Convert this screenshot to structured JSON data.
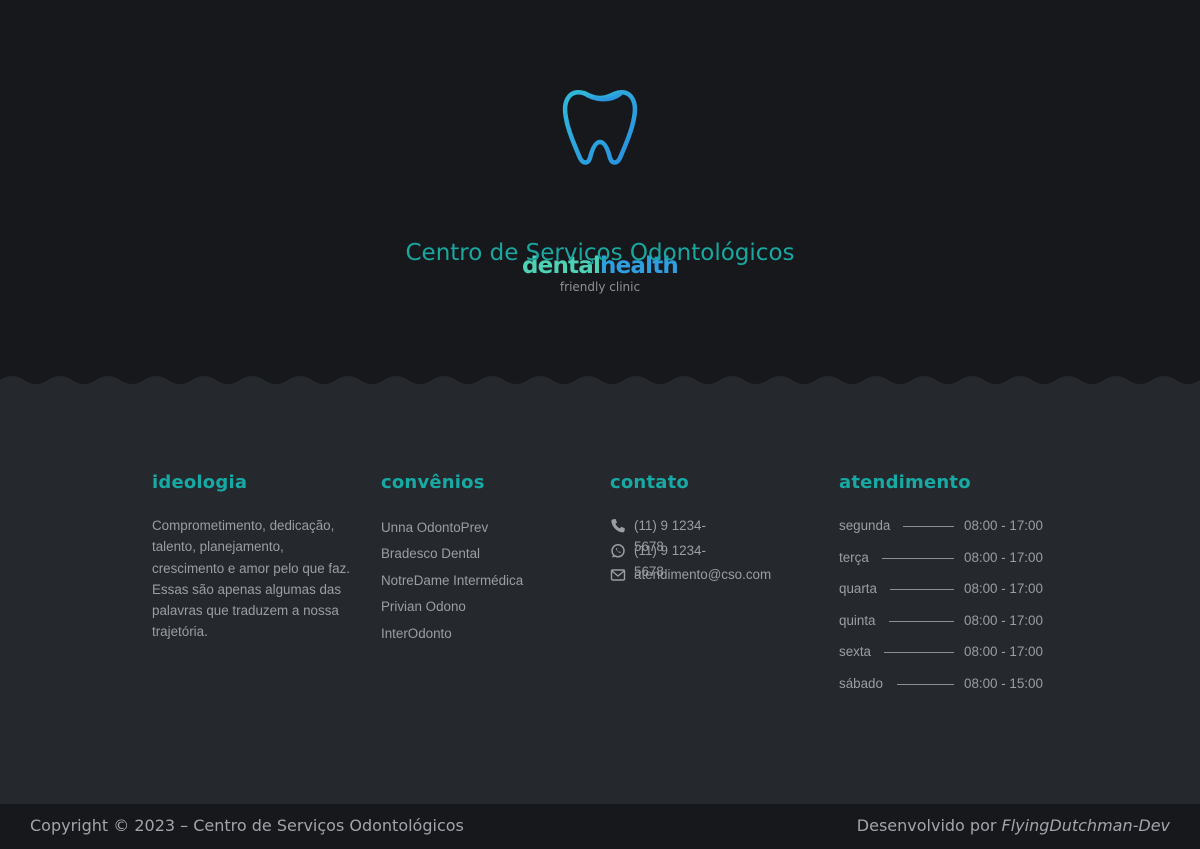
{
  "brand": {
    "name_part1": "dental",
    "name_part2": "health",
    "tagline": "friendly clinic",
    "colors": {
      "teal": "#4fd1b5",
      "blue": "#2f9fe0",
      "accent": "#17a9a3"
    }
  },
  "hero": {
    "title": "Centro de Serviços Odontológicos"
  },
  "ideologia": {
    "heading": "ideologia",
    "text": "Comprometimento, dedicação, talento, planejamento, crescimento e amor pelo que faz. Essas são apenas algumas das palavras que traduzem a nossa trajetória."
  },
  "convenios": {
    "heading": "convênios",
    "items": [
      "Unna OdontoPrev",
      "Bradesco Dental",
      "NotreDame Intermédica",
      "Privian Odono",
      "InterOdonto"
    ]
  },
  "contato": {
    "heading": "contato",
    "phone": "(11) 9 1234-5678",
    "whatsapp": "(11) 9 1234-5678",
    "email": "atendimento@cso.com",
    "icons": [
      "phone-icon",
      "whatsapp-icon",
      "envelope-icon"
    ]
  },
  "atendimento": {
    "heading": "atendimento",
    "rows": [
      {
        "day": "segunda",
        "time": "08:00 - 17:00"
      },
      {
        "day": "terça",
        "time": "08:00 - 17:00"
      },
      {
        "day": "quarta",
        "time": "08:00 - 17:00"
      },
      {
        "day": "quinta",
        "time": "08:00 - 17:00"
      },
      {
        "day": "sexta",
        "time": "08:00 - 17:00"
      },
      {
        "day": "sábado",
        "time": "08:00 - 15:00"
      }
    ]
  },
  "bottom_bar": {
    "copyright": "Copyright © 2023 – Centro de Serviços Odontológicos",
    "developed_by": "Desenvolvido por",
    "developer": "FlyingDutchman-Dev"
  }
}
